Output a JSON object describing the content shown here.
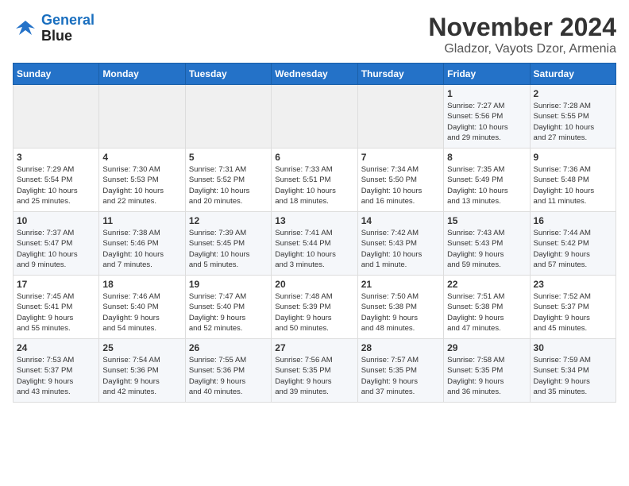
{
  "logo": {
    "line1": "General",
    "line2": "Blue"
  },
  "title": "November 2024",
  "location": "Gladzor, Vayots Dzor, Armenia",
  "days_of_week": [
    "Sunday",
    "Monday",
    "Tuesday",
    "Wednesday",
    "Thursday",
    "Friday",
    "Saturday"
  ],
  "weeks": [
    [
      {
        "num": "",
        "info": ""
      },
      {
        "num": "",
        "info": ""
      },
      {
        "num": "",
        "info": ""
      },
      {
        "num": "",
        "info": ""
      },
      {
        "num": "",
        "info": ""
      },
      {
        "num": "1",
        "info": "Sunrise: 7:27 AM\nSunset: 5:56 PM\nDaylight: 10 hours\nand 29 minutes."
      },
      {
        "num": "2",
        "info": "Sunrise: 7:28 AM\nSunset: 5:55 PM\nDaylight: 10 hours\nand 27 minutes."
      }
    ],
    [
      {
        "num": "3",
        "info": "Sunrise: 7:29 AM\nSunset: 5:54 PM\nDaylight: 10 hours\nand 25 minutes."
      },
      {
        "num": "4",
        "info": "Sunrise: 7:30 AM\nSunset: 5:53 PM\nDaylight: 10 hours\nand 22 minutes."
      },
      {
        "num": "5",
        "info": "Sunrise: 7:31 AM\nSunset: 5:52 PM\nDaylight: 10 hours\nand 20 minutes."
      },
      {
        "num": "6",
        "info": "Sunrise: 7:33 AM\nSunset: 5:51 PM\nDaylight: 10 hours\nand 18 minutes."
      },
      {
        "num": "7",
        "info": "Sunrise: 7:34 AM\nSunset: 5:50 PM\nDaylight: 10 hours\nand 16 minutes."
      },
      {
        "num": "8",
        "info": "Sunrise: 7:35 AM\nSunset: 5:49 PM\nDaylight: 10 hours\nand 13 minutes."
      },
      {
        "num": "9",
        "info": "Sunrise: 7:36 AM\nSunset: 5:48 PM\nDaylight: 10 hours\nand 11 minutes."
      }
    ],
    [
      {
        "num": "10",
        "info": "Sunrise: 7:37 AM\nSunset: 5:47 PM\nDaylight: 10 hours\nand 9 minutes."
      },
      {
        "num": "11",
        "info": "Sunrise: 7:38 AM\nSunset: 5:46 PM\nDaylight: 10 hours\nand 7 minutes."
      },
      {
        "num": "12",
        "info": "Sunrise: 7:39 AM\nSunset: 5:45 PM\nDaylight: 10 hours\nand 5 minutes."
      },
      {
        "num": "13",
        "info": "Sunrise: 7:41 AM\nSunset: 5:44 PM\nDaylight: 10 hours\nand 3 minutes."
      },
      {
        "num": "14",
        "info": "Sunrise: 7:42 AM\nSunset: 5:43 PM\nDaylight: 10 hours\nand 1 minute."
      },
      {
        "num": "15",
        "info": "Sunrise: 7:43 AM\nSunset: 5:43 PM\nDaylight: 9 hours\nand 59 minutes."
      },
      {
        "num": "16",
        "info": "Sunrise: 7:44 AM\nSunset: 5:42 PM\nDaylight: 9 hours\nand 57 minutes."
      }
    ],
    [
      {
        "num": "17",
        "info": "Sunrise: 7:45 AM\nSunset: 5:41 PM\nDaylight: 9 hours\nand 55 minutes."
      },
      {
        "num": "18",
        "info": "Sunrise: 7:46 AM\nSunset: 5:40 PM\nDaylight: 9 hours\nand 54 minutes."
      },
      {
        "num": "19",
        "info": "Sunrise: 7:47 AM\nSunset: 5:40 PM\nDaylight: 9 hours\nand 52 minutes."
      },
      {
        "num": "20",
        "info": "Sunrise: 7:48 AM\nSunset: 5:39 PM\nDaylight: 9 hours\nand 50 minutes."
      },
      {
        "num": "21",
        "info": "Sunrise: 7:50 AM\nSunset: 5:38 PM\nDaylight: 9 hours\nand 48 minutes."
      },
      {
        "num": "22",
        "info": "Sunrise: 7:51 AM\nSunset: 5:38 PM\nDaylight: 9 hours\nand 47 minutes."
      },
      {
        "num": "23",
        "info": "Sunrise: 7:52 AM\nSunset: 5:37 PM\nDaylight: 9 hours\nand 45 minutes."
      }
    ],
    [
      {
        "num": "24",
        "info": "Sunrise: 7:53 AM\nSunset: 5:37 PM\nDaylight: 9 hours\nand 43 minutes."
      },
      {
        "num": "25",
        "info": "Sunrise: 7:54 AM\nSunset: 5:36 PM\nDaylight: 9 hours\nand 42 minutes."
      },
      {
        "num": "26",
        "info": "Sunrise: 7:55 AM\nSunset: 5:36 PM\nDaylight: 9 hours\nand 40 minutes."
      },
      {
        "num": "27",
        "info": "Sunrise: 7:56 AM\nSunset: 5:35 PM\nDaylight: 9 hours\nand 39 minutes."
      },
      {
        "num": "28",
        "info": "Sunrise: 7:57 AM\nSunset: 5:35 PM\nDaylight: 9 hours\nand 37 minutes."
      },
      {
        "num": "29",
        "info": "Sunrise: 7:58 AM\nSunset: 5:35 PM\nDaylight: 9 hours\nand 36 minutes."
      },
      {
        "num": "30",
        "info": "Sunrise: 7:59 AM\nSunset: 5:34 PM\nDaylight: 9 hours\nand 35 minutes."
      }
    ]
  ]
}
